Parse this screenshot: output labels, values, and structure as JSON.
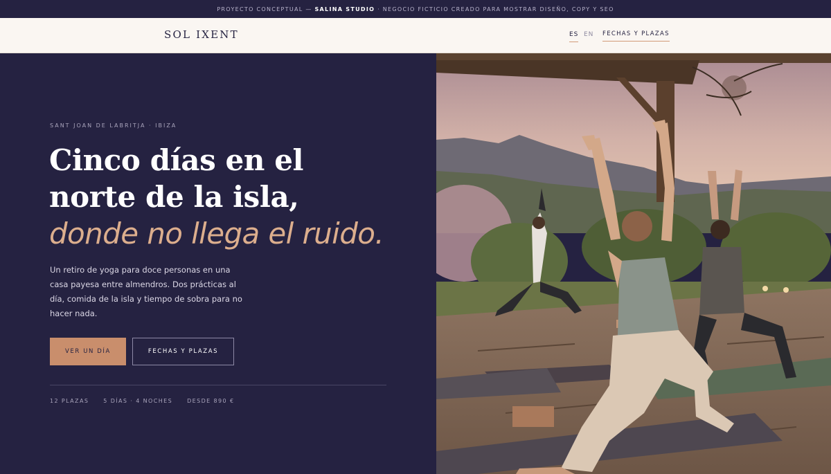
{
  "topbar": {
    "prefix": "PROYECTO CONCEPTUAL —",
    "studio": "SALINA STUDIO",
    "suffix": "· NEGOCIO FICTICIO CREADO PARA MOSTRAR DISEÑO, COPY Y SEO"
  },
  "header": {
    "logo": "SOL IXENT",
    "lang_es": "ES",
    "lang_en": "EN",
    "active_lang": "ES",
    "cta": "FECHAS Y PLAZAS"
  },
  "hero": {
    "eyebrow": "SANT JOAN DE LABRITJA · IBIZA",
    "headline_plain": "Cinco días en el norte de la isla,",
    "headline_accent": "donde no llega el ruido.",
    "lead": "Un retiro de yoga para doce personas en una casa payesa entre almendros. Dos prácticas al día, comida de la isla y tiempo de sobra para no hacer nada.",
    "primary_button": "VER UN DÍA",
    "secondary_button": "FECHAS Y PLAZAS",
    "stats": [
      "12 PLAZAS",
      "5 DÍAS · 4 NOCHES",
      "DESDE 890 €"
    ]
  },
  "colors": {
    "navy": "#252241",
    "cream": "#faf6f2",
    "accent": "#c98e6c",
    "accent_text": "#dcae8d"
  },
  "icons": {
    "hero_image": "yoga-group-photo"
  }
}
